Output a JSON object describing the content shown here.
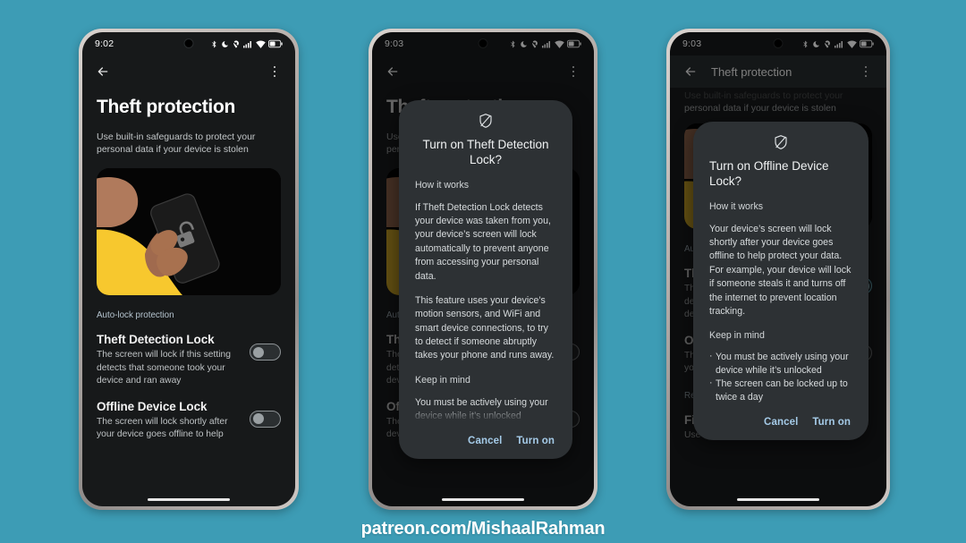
{
  "background_color": "#3d9cb5",
  "footer": {
    "text": "patreon.com/MishaalRahman"
  },
  "status_bar": {
    "time_phone1": "9:02",
    "time_phone2": "9:03",
    "time_phone3": "9:03",
    "icons": [
      "bluetooth-icon",
      "do-not-disturb-moon-icon",
      "location-off-icon",
      "cellular-signal-icon",
      "wifi-icon",
      "battery-icon"
    ],
    "battery_level": "45"
  },
  "phone1": {
    "app_bar": {
      "back": "back-arrow-icon",
      "overflow": "overflow-menu-icon"
    },
    "page_title": "Theft protection",
    "page_subtitle": "Use built-in safeguards to protect your personal data if your device is stolen",
    "hero_illustration": "person-holding-phone-with-unlocked-padlock",
    "section_label": "Auto-lock protection",
    "settings": [
      {
        "title": "Theft Detection Lock",
        "description": "The screen will lock if this setting detects that someone took your device and ran away",
        "toggle_state": "off"
      },
      {
        "title": "Offline Device Lock",
        "description": "The screen will lock shortly after your device goes offline to help",
        "toggle_state": "off"
      }
    ]
  },
  "phone2": {
    "background": {
      "page_title": "Theft protection",
      "page_subtitle": "Use built-in safeguards to protect your personal data if your device is stolen",
      "section_label": "Auto-lock protection",
      "setting1_title": "Theft Detection Lock",
      "setting1_desc": "The screen will lock if this setting detects that someone took your device and ran away",
      "setting2_title": "Offline Device Lock",
      "setting2_desc": "The screen will lock shortly after your device goes offline to help"
    },
    "dialog": {
      "icon": "shield-off-icon",
      "title": "Turn on Theft Detection Lock?",
      "how_heading": "How it works",
      "how_para1": "If Theft Detection Lock detects your device was taken from you, your device’s screen will lock automatically to prevent anyone from accessing your personal data.",
      "how_para2": "This feature uses your device’s motion sensors, and WiFi and smart device connections, to try to detect if someone abruptly takes your phone and runs away.",
      "keep_heading": "Keep in mind",
      "keep_para": "You must be actively using your device while it’s unlocked",
      "cancel_label": "Cancel",
      "confirm_label": "Turn on"
    }
  },
  "phone3": {
    "app_bar": {
      "title": "Theft protection"
    },
    "background": {
      "subtitle_clipped": "Use built-in safeguards to protect your",
      "subtitle_line2": "personal data if your device is stolen",
      "section_label_a": "Auto-lock protection",
      "setting1_title": "Theft Detection Lock",
      "setting2_title": "Offline Device Lock",
      "section_label_b": "Remotely secure device",
      "find_title": "Find & erase your device",
      "find_desc": "Use Find My Device to locate or erase your"
    },
    "dialog": {
      "icon": "shield-off-icon",
      "title": "Turn on Offline Device Lock?",
      "how_heading": "How it works",
      "how_para1": "Your device’s screen will lock shortly after your device goes offline to help protect your data. For example, your device will lock if someone steals it and turns off the internet to prevent location tracking.",
      "keep_heading": "Keep in mind",
      "keep_items": [
        "You must be actively using your device while it’s unlocked",
        "The screen can be locked up to twice a day"
      ],
      "cancel_label": "Cancel",
      "confirm_label": "Turn on"
    }
  }
}
